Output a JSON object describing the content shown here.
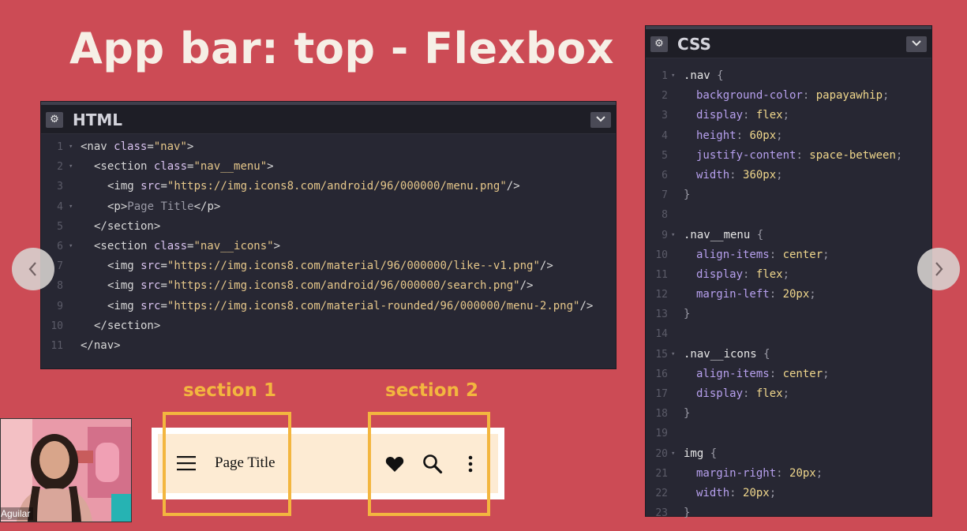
{
  "slide": {
    "title": "App bar: top - Flexbox"
  },
  "html_panel": {
    "title": "HTML",
    "lines": [
      {
        "n": "1",
        "fold": true,
        "indent": 0,
        "tokens": [
          [
            "tag",
            "<nav "
          ],
          [
            "attr",
            "class"
          ],
          [
            "tag",
            "="
          ],
          [
            "str",
            "\"nav\""
          ],
          [
            "tag",
            ">"
          ]
        ]
      },
      {
        "n": "2",
        "fold": true,
        "indent": 1,
        "tokens": [
          [
            "tag",
            "<section "
          ],
          [
            "attr",
            "class"
          ],
          [
            "tag",
            "="
          ],
          [
            "str",
            "\"nav__menu\""
          ],
          [
            "tag",
            ">"
          ]
        ]
      },
      {
        "n": "3",
        "fold": false,
        "indent": 2,
        "tokens": [
          [
            "tag",
            "<img "
          ],
          [
            "attr",
            "src"
          ],
          [
            "tag",
            "="
          ],
          [
            "str",
            "\"https://img.icons8.com/android/96/000000/menu.png\""
          ],
          [
            "tag",
            "/>"
          ]
        ]
      },
      {
        "n": "4",
        "fold": true,
        "indent": 2,
        "tokens": [
          [
            "tag",
            "<p>"
          ],
          [
            "plain",
            "Page Title"
          ],
          [
            "tag",
            "</p>"
          ]
        ]
      },
      {
        "n": "5",
        "fold": false,
        "indent": 1,
        "tokens": [
          [
            "tag",
            "</section>"
          ]
        ]
      },
      {
        "n": "6",
        "fold": true,
        "indent": 1,
        "tokens": [
          [
            "tag",
            "<section "
          ],
          [
            "attr",
            "class"
          ],
          [
            "tag",
            "="
          ],
          [
            "str",
            "\"nav__icons\""
          ],
          [
            "tag",
            ">"
          ]
        ]
      },
      {
        "n": "7",
        "fold": false,
        "indent": 2,
        "tokens": [
          [
            "tag",
            "<img "
          ],
          [
            "attr",
            "src"
          ],
          [
            "tag",
            "="
          ],
          [
            "str",
            "\"https://img.icons8.com/material/96/000000/like--v1.png\""
          ],
          [
            "tag",
            "/>"
          ]
        ]
      },
      {
        "n": "8",
        "fold": false,
        "indent": 2,
        "tokens": [
          [
            "tag",
            "<img "
          ],
          [
            "attr",
            "src"
          ],
          [
            "tag",
            "="
          ],
          [
            "str",
            "\"https://img.icons8.com/android/96/000000/search.png\""
          ],
          [
            "tag",
            "/>"
          ]
        ]
      },
      {
        "n": "9",
        "fold": false,
        "indent": 2,
        "tokens": [
          [
            "tag",
            "<img "
          ],
          [
            "attr",
            "src"
          ],
          [
            "tag",
            "="
          ],
          [
            "str",
            "\"https://img.icons8.com/material-rounded/96/000000/menu-2.png\""
          ],
          [
            "tag",
            "/>"
          ]
        ]
      },
      {
        "n": "10",
        "fold": false,
        "indent": 1,
        "tokens": [
          [
            "tag",
            "</section>"
          ]
        ]
      },
      {
        "n": "11",
        "fold": false,
        "indent": 0,
        "tokens": [
          [
            "tag",
            "</nav>"
          ]
        ]
      }
    ]
  },
  "css_panel": {
    "title": "CSS",
    "lines": [
      {
        "n": "1",
        "fold": true,
        "indent": 0,
        "tokens": [
          [
            "sel",
            ".nav "
          ],
          [
            "brace",
            "{"
          ]
        ]
      },
      {
        "n": "2",
        "fold": false,
        "indent": 1,
        "tokens": [
          [
            "prop",
            "background-color"
          ],
          [
            "brace",
            ": "
          ],
          [
            "val",
            "papayawhip"
          ],
          [
            "brace",
            ";"
          ]
        ]
      },
      {
        "n": "3",
        "fold": false,
        "indent": 1,
        "tokens": [
          [
            "prop",
            "display"
          ],
          [
            "brace",
            ": "
          ],
          [
            "val",
            "flex"
          ],
          [
            "brace",
            ";"
          ]
        ]
      },
      {
        "n": "4",
        "fold": false,
        "indent": 1,
        "tokens": [
          [
            "prop",
            "height"
          ],
          [
            "brace",
            ": "
          ],
          [
            "val",
            "60px"
          ],
          [
            "brace",
            ";"
          ]
        ]
      },
      {
        "n": "5",
        "fold": false,
        "indent": 1,
        "tokens": [
          [
            "prop",
            "justify-content"
          ],
          [
            "brace",
            ": "
          ],
          [
            "val",
            "space-between"
          ],
          [
            "brace",
            ";"
          ]
        ]
      },
      {
        "n": "6",
        "fold": false,
        "indent": 1,
        "tokens": [
          [
            "prop",
            "width"
          ],
          [
            "brace",
            ": "
          ],
          [
            "val",
            "360px"
          ],
          [
            "brace",
            ";"
          ]
        ]
      },
      {
        "n": "7",
        "fold": false,
        "indent": 0,
        "tokens": [
          [
            "brace",
            "}"
          ]
        ]
      },
      {
        "n": "8",
        "fold": false,
        "indent": 0,
        "tokens": []
      },
      {
        "n": "9",
        "fold": true,
        "indent": 0,
        "tokens": [
          [
            "sel",
            ".nav__menu "
          ],
          [
            "brace",
            "{"
          ]
        ]
      },
      {
        "n": "10",
        "fold": false,
        "indent": 1,
        "tokens": [
          [
            "prop",
            "align-items"
          ],
          [
            "brace",
            ": "
          ],
          [
            "val",
            "center"
          ],
          [
            "brace",
            ";"
          ]
        ]
      },
      {
        "n": "11",
        "fold": false,
        "indent": 1,
        "tokens": [
          [
            "prop",
            "display"
          ],
          [
            "brace",
            ": "
          ],
          [
            "val",
            "flex"
          ],
          [
            "brace",
            ";"
          ]
        ]
      },
      {
        "n": "12",
        "fold": false,
        "indent": 1,
        "tokens": [
          [
            "prop",
            "margin-left"
          ],
          [
            "brace",
            ": "
          ],
          [
            "val",
            "20px"
          ],
          [
            "brace",
            ";"
          ]
        ]
      },
      {
        "n": "13",
        "fold": false,
        "indent": 0,
        "tokens": [
          [
            "brace",
            "}"
          ]
        ]
      },
      {
        "n": "14",
        "fold": false,
        "indent": 0,
        "tokens": []
      },
      {
        "n": "15",
        "fold": true,
        "indent": 0,
        "tokens": [
          [
            "sel",
            ".nav__icons "
          ],
          [
            "brace",
            "{"
          ]
        ]
      },
      {
        "n": "16",
        "fold": false,
        "indent": 1,
        "tokens": [
          [
            "prop",
            "align-items"
          ],
          [
            "brace",
            ": "
          ],
          [
            "val",
            "center"
          ],
          [
            "brace",
            ";"
          ]
        ]
      },
      {
        "n": "17",
        "fold": false,
        "indent": 1,
        "tokens": [
          [
            "prop",
            "display"
          ],
          [
            "brace",
            ": "
          ],
          [
            "val",
            "flex"
          ],
          [
            "brace",
            ";"
          ]
        ]
      },
      {
        "n": "18",
        "fold": false,
        "indent": 0,
        "tokens": [
          [
            "brace",
            "}"
          ]
        ]
      },
      {
        "n": "19",
        "fold": false,
        "indent": 0,
        "tokens": []
      },
      {
        "n": "20",
        "fold": true,
        "indent": 0,
        "tokens": [
          [
            "sel",
            "img "
          ],
          [
            "brace",
            "{"
          ]
        ]
      },
      {
        "n": "21",
        "fold": false,
        "indent": 1,
        "tokens": [
          [
            "prop",
            "margin-right"
          ],
          [
            "brace",
            ": "
          ],
          [
            "val",
            "20px"
          ],
          [
            "brace",
            ";"
          ]
        ]
      },
      {
        "n": "22",
        "fold": false,
        "indent": 1,
        "tokens": [
          [
            "prop",
            "width"
          ],
          [
            "brace",
            ": "
          ],
          [
            "val",
            "20px"
          ],
          [
            "brace",
            ";"
          ]
        ]
      },
      {
        "n": "23",
        "fold": false,
        "indent": 0,
        "tokens": [
          [
            "brace",
            "}"
          ]
        ]
      }
    ]
  },
  "demo": {
    "section1_label": "section 1",
    "section2_label": "section 2",
    "page_title": "Page Title"
  },
  "webcam": {
    "name": "Aguilar"
  },
  "colors": {
    "background": "#cc4b55",
    "highlight": "#f3b63f",
    "appbar": "#fdebd3",
    "editor": "#272733"
  }
}
